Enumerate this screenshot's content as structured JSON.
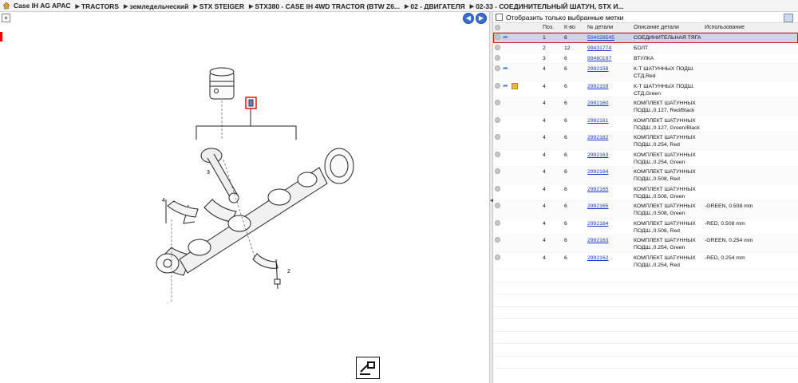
{
  "breadcrumb": [
    "Case IH AG APAC",
    "TRACTORS",
    "земледельческий",
    "STX STEIGER",
    "STX380 - CASE IH 4WD TRACTOR (BTW Z6...",
    "02 - ДВИГАТЕЛЯ",
    "02-33 - СОЕДИНИТЕЛЬНЫЙ ШАТУН, STX И..."
  ],
  "filter_label": "Отобразить только выбранные метки",
  "columns": {
    "pos": "Поз.",
    "qty": "К-во",
    "part": "№ детали",
    "desc": "Описание детали",
    "use": "Использование"
  },
  "rows": [
    {
      "pos": "1",
      "qty": "6",
      "part": "504028545",
      "desc": "СОЕДИНИТЕЛЬНАЯ ТЯГА",
      "use": "",
      "icons": [
        "circle",
        "link"
      ],
      "selected": true
    },
    {
      "pos": "2",
      "qty": "12",
      "part": "99431774",
      "desc": "БОЛТ",
      "use": "",
      "icons": [
        "circle"
      ]
    },
    {
      "pos": "3",
      "qty": "6",
      "part": "99460197",
      "desc": "ВТУЛКА",
      "use": "",
      "icons": [
        "circle"
      ]
    },
    {
      "pos": "4",
      "qty": "6",
      "part": "2992158",
      "desc": "К-Т ШАТУННЫХ ПОДШ. СТД,Red",
      "use": "",
      "icons": [
        "circle",
        "link"
      ]
    },
    {
      "pos": "4",
      "qty": "6",
      "part": "2992159",
      "desc": "К-Т ШАТУННЫХ ПОДШ. СТД,Green",
      "use": "",
      "icons": [
        "circle",
        "link",
        "cube"
      ]
    },
    {
      "pos": "4",
      "qty": "6",
      "part": "2992160",
      "desc": "КОМПЛЕКТ ШАТУННЫХ ПОДШ.,0.127, Red/Black",
      "use": "",
      "icons": [
        "circle"
      ]
    },
    {
      "pos": "4",
      "qty": "6",
      "part": "2992161",
      "desc": "КОМПЛЕКТ ШАТУННЫХ ПОДШ.,0.127, Green/Black",
      "use": "",
      "icons": [
        "circle"
      ]
    },
    {
      "pos": "4",
      "qty": "6",
      "part": "2992162",
      "desc": "КОМПЛЕКТ ШАТУННЫХ ПОДШ.,0.254, Red",
      "use": "",
      "icons": [
        "circle"
      ]
    },
    {
      "pos": "4",
      "qty": "6",
      "part": "2992163",
      "desc": "КОМПЛЕКТ ШАТУННЫХ ПОДШ.,0.254, Green",
      "use": "",
      "icons": [
        "circle"
      ]
    },
    {
      "pos": "4",
      "qty": "6",
      "part": "2992164",
      "desc": "КОМПЛЕКТ ШАТУННЫХ ПОДШ.,0.508, Red",
      "use": "",
      "icons": [
        "circle"
      ]
    },
    {
      "pos": "4",
      "qty": "6",
      "part": "2992165",
      "desc": "КОМПЛЕКТ ШАТУННЫХ ПОДШ.,0.508, Green",
      "use": "",
      "icons": [
        "circle"
      ]
    },
    {
      "pos": "4",
      "qty": "6",
      "part": "2992165",
      "desc": "КОМПЛЕКТ ШАТУННЫХ ПОДШ.,0.508, Green",
      "use": "-GREEN, 0.508 mm",
      "icons": [
        "circle"
      ]
    },
    {
      "pos": "4",
      "qty": "6",
      "part": "2992164",
      "desc": "КОМПЛЕКТ ШАТУННЫХ ПОДШ.,0.508, Red",
      "use": "-RED, 0.508 mm",
      "icons": [
        "circle"
      ]
    },
    {
      "pos": "4",
      "qty": "6",
      "part": "2992163",
      "desc": "КОМПЛЕКТ ШАТУННЫХ ПОДШ.,0.254, Green",
      "use": "-GREEN, 0.254 mm",
      "icons": [
        "circle"
      ]
    },
    {
      "pos": "4",
      "qty": "6",
      "part": "2992162",
      "desc": "КОМПЛЕКТ ШАТУННЫХ ПОДШ.,0.254, Red",
      "use": "-RED, 0.254 mm",
      "icons": [
        "circle"
      ]
    }
  ],
  "diagram_callouts": [
    "2",
    "3",
    "4",
    "4"
  ],
  "colors": {
    "selection": "#c9d6ea",
    "highlight": "#d9141b",
    "link": "#1a37c9",
    "nav": "#3a6ed0"
  },
  "icons": {
    "home": "home-icon",
    "back": "back-arrow-icon",
    "forward": "forward-arrow-icon",
    "export": "export-icon"
  }
}
